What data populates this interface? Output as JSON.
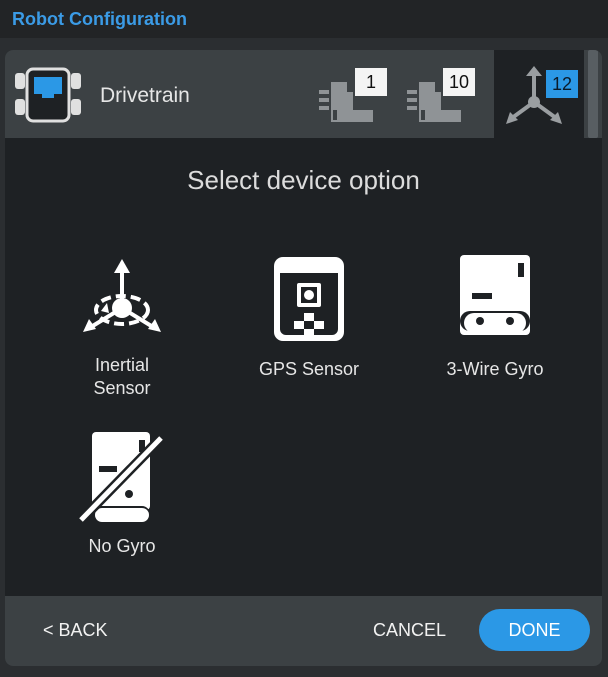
{
  "app": {
    "title": "Robot Configuration"
  },
  "header": {
    "device_label": "Drivetrain",
    "ports": [
      {
        "number": "1",
        "icon": "motor-icon",
        "selected": false
      },
      {
        "number": "10",
        "icon": "motor-icon",
        "selected": false
      },
      {
        "number": "12",
        "icon": "inertial-icon",
        "selected": true
      }
    ]
  },
  "main": {
    "heading": "Select device option",
    "options": [
      {
        "label": "Inertial\nSensor",
        "icon": "inertial-sensor-icon"
      },
      {
        "label": "GPS Sensor",
        "icon": "gps-sensor-icon"
      },
      {
        "label": "3-Wire Gyro",
        "icon": "three-wire-gyro-icon"
      },
      {
        "label": "No Gyro",
        "icon": "no-gyro-icon"
      }
    ]
  },
  "footer": {
    "back_label": "< BACK",
    "cancel_label": "CANCEL",
    "done_label": "DONE"
  },
  "colors": {
    "accent": "#2b98e6",
    "title": "#3b9be6",
    "panel": "#1e2124",
    "header": "#3c4144"
  }
}
